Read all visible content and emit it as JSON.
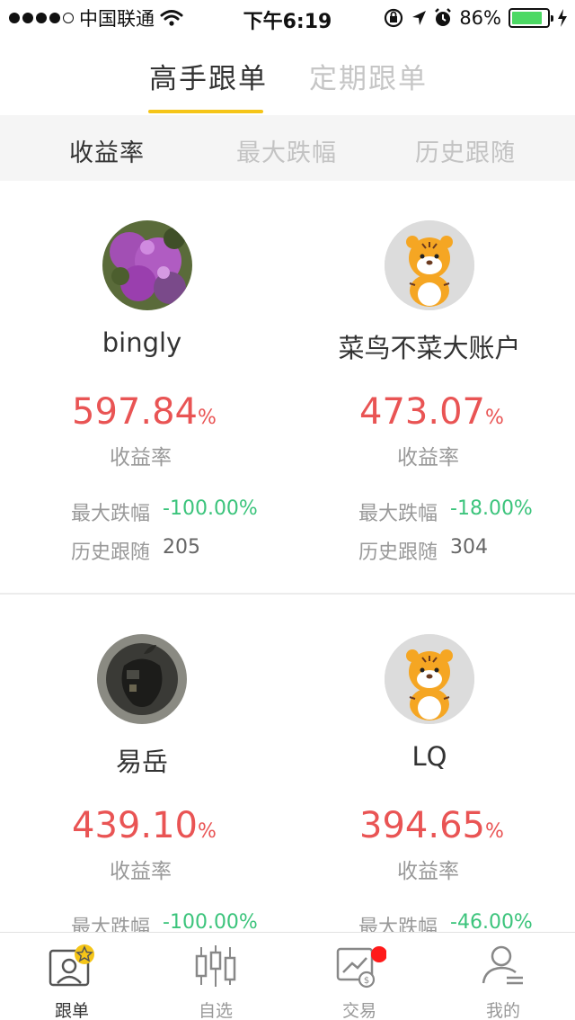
{
  "status_bar": {
    "carrier": "中国联通",
    "time": "下午6:19",
    "battery": "86%",
    "battery_level": 0.86
  },
  "top_tabs": [
    "高手跟单",
    "定期跟单"
  ],
  "sort_tabs": [
    "收益率",
    "最大跌幅",
    "历史跟随"
  ],
  "traders": [
    {
      "name": "bingly",
      "return_value": "597.84",
      "return_unit": "%",
      "return_label": "收益率",
      "drawdown_label": "最大跌幅",
      "drawdown": "-100.00%",
      "followers_label": "历史跟随",
      "followers": "205",
      "avatar_icon": "flower-photo"
    },
    {
      "name": "菜鸟不菜大账户",
      "return_value": "473.07",
      "return_unit": "%",
      "return_label": "收益率",
      "drawdown_label": "最大跌幅",
      "drawdown": "-18.00%",
      "followers_label": "历史跟随",
      "followers": "304",
      "avatar_icon": "tiger-avatar"
    },
    {
      "name": "易岳",
      "return_value": "439.10",
      "return_unit": "%",
      "return_label": "收益率",
      "drawdown_label": "最大跌幅",
      "drawdown": "-100.00%",
      "avatar_icon": "apple-photo"
    },
    {
      "name": "LQ",
      "return_value": "394.65",
      "return_unit": "%",
      "return_label": "收益率",
      "drawdown_label": "最大跌幅",
      "drawdown": "-46.00%",
      "avatar_icon": "tiger-avatar"
    }
  ],
  "bottom_tabs": [
    {
      "label": "跟单",
      "icon": "follow-icon",
      "active": true
    },
    {
      "label": "自选",
      "icon": "candlestick-icon",
      "active": false
    },
    {
      "label": "交易",
      "icon": "trade-icon",
      "active": false
    },
    {
      "label": "我的",
      "icon": "profile-icon",
      "active": false
    }
  ],
  "colors": {
    "accent": "#f5c518",
    "positive": "#e95454",
    "negative": "#3cc47c",
    "badge": "#ff1a1a"
  }
}
